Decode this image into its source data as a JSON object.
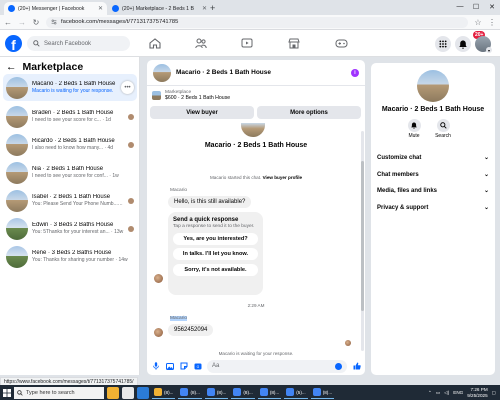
{
  "browser": {
    "tabs": [
      {
        "title": "(20+) Messenger | Facebook",
        "active": true
      },
      {
        "title": "(20+) Marketplace - 2 Beds 1 B",
        "active": false
      }
    ],
    "url": "facebook.com/messages/t/7713173757417 85",
    "url_text": "facebook.com/messages/t/771317375741785",
    "status_url": "https://www.facebook.com/messages/t/771317375741785/"
  },
  "fb": {
    "logo": "f",
    "search_placeholder": "Search Facebook",
    "notif_badge": "20+",
    "accent": "#0866ff"
  },
  "left": {
    "title": "Marketplace",
    "chats": [
      {
        "name": "Macario · 2 Beds 1 Bath House",
        "sub": "Macario is waiting for your response.",
        "active": true
      },
      {
        "name": "Braden · 2 Beds 1 Bath House",
        "sub": "I need to see your score for c...",
        "time": "1d"
      },
      {
        "name": "Ricardo · 2 Beds 1 Bath House",
        "sub": "I also need to know how many...",
        "time": "4d"
      },
      {
        "name": "Nia · 2 Beds 1 Bath House",
        "sub": "I need to see your score for conf...",
        "time": "1w"
      },
      {
        "name": "Isabel · 2 Beds 1 Bath House",
        "sub": "You: Please Send Your Phone Numb...",
        "time": "1w"
      },
      {
        "name": "Edwin · 3 Beds 2 Baths House",
        "sub": "You: 5Thanks for your interest an...",
        "time": "13w"
      },
      {
        "name": "Rene · 3 Beds 2 Baths House",
        "sub": "You: Thanks for sharing your number",
        "time": "14w"
      }
    ]
  },
  "conversation": {
    "title": "Macario · 2 Beds 1 Bath House",
    "listing_category": "Marketplace",
    "listing_title": "$600 · 2 Beds 1 Bath House",
    "view_buyer": "View buyer",
    "more_options": "More options",
    "hero_name": "Macario · 2 Beds 1 Bath House",
    "started_text": "Macario started this chat.",
    "view_profile": "View buyer profile",
    "sender_label": "Macario",
    "first_msg": "Hello, is this still available?",
    "quick_title": "Send a quick response",
    "quick_sub": "Tap a response to send it to the buyer.",
    "quick_replies": [
      "Yes, are you interested?",
      "In talks. I'll let you know.",
      "Sorry, it's not available."
    ],
    "timestamp": "2:29 AM",
    "sender_label_2": "Macario",
    "phone_msg": "9562452094",
    "waiting": "Macario is waiting for your response.",
    "composer_placeholder": "Aa"
  },
  "right": {
    "name": "Macario · 2 Beds 1 Bath House",
    "mute": "Mute",
    "search": "Search",
    "sections": [
      "Customize chat",
      "Chat members",
      "Media, files and links",
      "Privacy & support"
    ]
  },
  "taskbar": {
    "search_placeholder": "Type here to search",
    "apps": [
      "(8)...",
      "(8)...",
      "(8)...",
      "(8)...",
      "(8)...",
      "(5)...",
      "(8)..."
    ],
    "lang": "ENG",
    "time": "7:26 PM",
    "date": "9/25/2025"
  }
}
